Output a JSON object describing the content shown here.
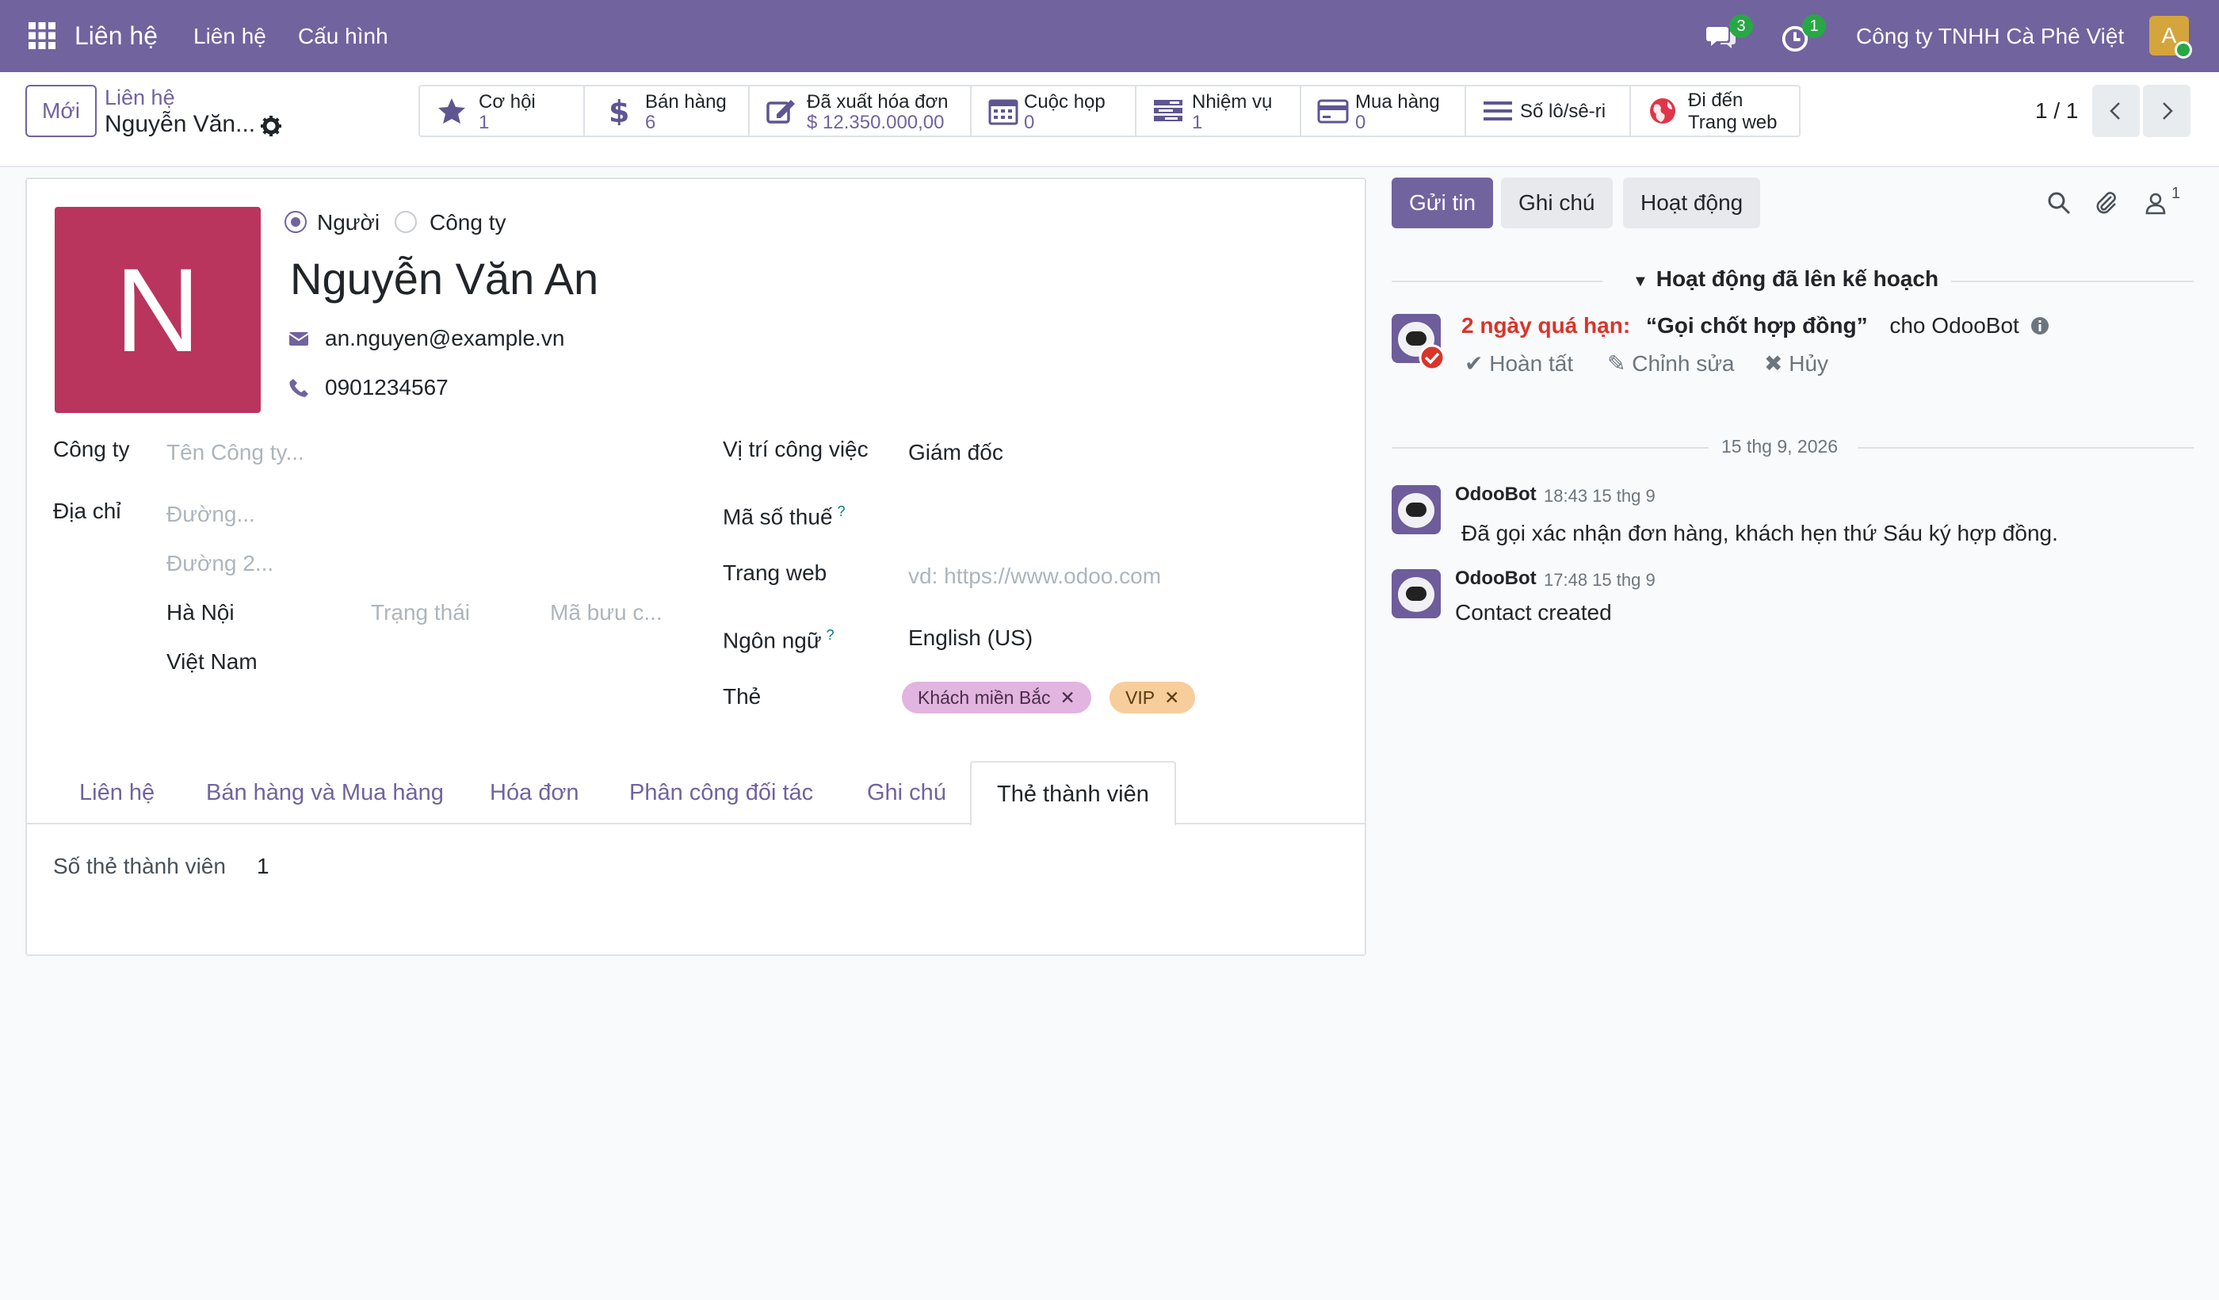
{
  "topbar": {
    "app_name": "Liên hệ",
    "menu": [
      "Liên hệ",
      "Cấu hình"
    ],
    "chat_count": "3",
    "activity_count": "1",
    "company": "Công ty TNHH Cà Phê Việt",
    "avatar_letter": "A"
  },
  "control": {
    "new_label": "Mới",
    "breadcrumb_parent": "Liên hệ",
    "breadcrumb_current": "Nguyễn Văn...",
    "pager": "1 / 1"
  },
  "smart_buttons": [
    {
      "label": "Cơ hội",
      "value": "1",
      "icon": "star-icon"
    },
    {
      "label": "Bán hàng",
      "value": "6",
      "icon": "dollar-icon"
    },
    {
      "label": "Đã xuất hóa đơn",
      "value": "$ 12.350.000,00",
      "icon": "pencil-square-icon"
    },
    {
      "label": "Cuộc họp",
      "value": "0",
      "icon": "calendar-icon"
    },
    {
      "label": "Nhiệm vụ",
      "value": "1",
      "icon": "tasks-icon"
    },
    {
      "label": "Mua hàng",
      "value": "0",
      "icon": "credit-card-icon"
    },
    {
      "label": "Số lô/sê-ri",
      "value": "",
      "icon": "bars-icon"
    },
    {
      "label": "Đi đến",
      "value": "Trang web",
      "icon": "globe-icon"
    }
  ],
  "form": {
    "photo_letter": "N",
    "type_person": "Người",
    "type_company": "Công ty",
    "name": "Nguyễn Văn An",
    "email": "an.nguyen@example.vn",
    "phone": "0901234567",
    "company_label": "Công ty",
    "company_placeholder": "Tên Công ty...",
    "address_label": "Địa chỉ",
    "street_placeholder": "Đường...",
    "street2_placeholder": "Đường 2...",
    "city": "Hà Nội",
    "state_placeholder": "Trạng thái",
    "zip_placeholder": "Mã bưu c...",
    "country": "Việt Nam",
    "job_label": "Vị trí công việc",
    "job_value": "Giám đốc",
    "vat_label": "Mã số thuế",
    "website_label": "Trang web",
    "website_placeholder": "vd: https://www.odoo.com",
    "lang_label": "Ngôn ngữ",
    "lang_value": "English (US)",
    "tags_label": "Thẻ",
    "tags": [
      {
        "label": "Khách miền Bắc",
        "color": "#e2b4e0"
      },
      {
        "label": "VIP",
        "color": "#f7cd9c"
      }
    ],
    "help_mark": "?"
  },
  "tabs": [
    "Liên hệ",
    "Bán hàng và Mua hàng",
    "Hóa đơn",
    "Phân công đối tác",
    "Ghi chú",
    "Thẻ thành viên"
  ],
  "membership": {
    "label": "Số thẻ thành viên",
    "value": "1"
  },
  "chatter": {
    "send_message": "Gửi tin",
    "log_note": "Ghi chú",
    "activity": "Hoạt động",
    "followers_count": "1",
    "planned_title": "Hoạt động đã lên kế hoạch",
    "activity_overdue": "2 ngày quá hạn:",
    "activity_summary": "“Gọi chốt hợp đồng”",
    "activity_for": "cho OdooBot",
    "op_done": "Hoàn tất",
    "op_edit": "Chỉnh sửa",
    "op_cancel": "Hủy",
    "date_sep": "15 thg 9, 2026",
    "messages": [
      {
        "author": "OdooBot",
        "time": "18:43 15 thg 9",
        "body": "Đã gọi xác nhận đơn hàng, khách hẹn thứ Sáu ký hợp đồng."
      },
      {
        "author": "OdooBot",
        "time": "17:48 15 thg 9",
        "body": "Contact created"
      }
    ]
  },
  "colors": {
    "brand": "#71639e",
    "overdue": "#d9342b",
    "photo": "#b9355e"
  }
}
